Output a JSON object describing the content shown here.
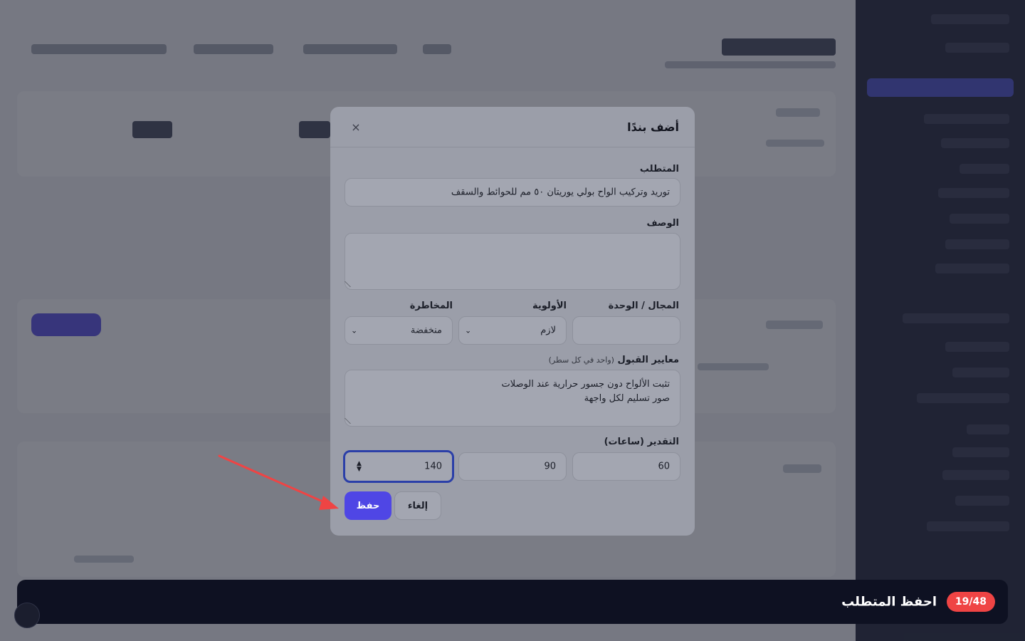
{
  "modal": {
    "title": "أضف بندًا",
    "close_symbol": "×",
    "requirement": {
      "label": "المتطلب",
      "value": "توريد وتركيب الواح بولي يوريتان ٥٠ مم للحوائط والسقف"
    },
    "description": {
      "label": "الوصف",
      "value": ""
    },
    "domain": {
      "label": "المجال / الوحدة",
      "value": ""
    },
    "priority": {
      "label": "الأولوية",
      "value": "لازم"
    },
    "risk": {
      "label": "المخاطرة",
      "value": "منخفضة"
    },
    "acceptance": {
      "label": "معايير القبول",
      "hint": "(واحد في كل سطر)",
      "lines": [
        "تثبت الألواح دون جسور حرارية عند الوصلات",
        "صور تسليم لكل واجهة"
      ]
    },
    "estimate": {
      "label": "التقدير (ساعات)",
      "values": [
        "60",
        "90",
        "140"
      ]
    },
    "save_label": "حفظ",
    "cancel_label": "إلغاء"
  },
  "banner": {
    "text": "احفظ المتطلب",
    "progress": "19/48"
  },
  "colors": {
    "accent": "#4f46e5",
    "highlight": "#ef4444",
    "banner_bg": "#0e1122"
  }
}
